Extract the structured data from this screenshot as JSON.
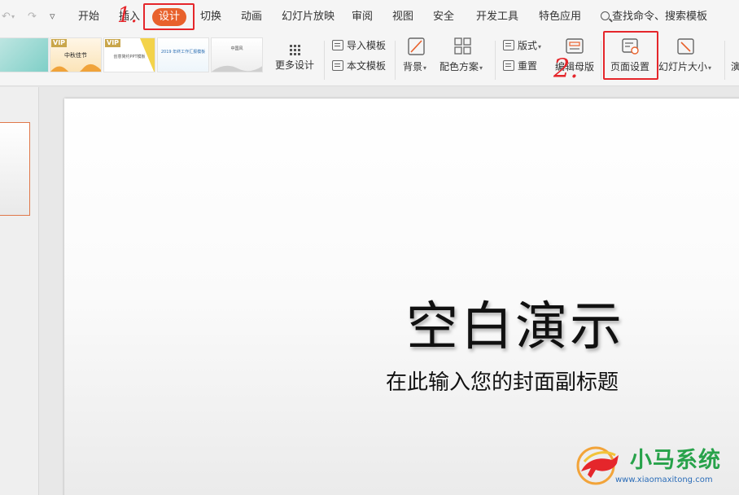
{
  "menu": {
    "tabs": [
      "开始",
      "插入",
      "设计",
      "切换",
      "动画",
      "幻灯片放映",
      "审阅",
      "视图",
      "安全",
      "开发工具",
      "特色应用"
    ],
    "active_tab": "设计",
    "search": "查找命令、搜索模板"
  },
  "ribbon": {
    "templates": [
      {
        "vip": "",
        "text": ""
      },
      {
        "vip": "VIP",
        "text": "中秋佳节"
      },
      {
        "vip": "VIP",
        "text": "创意简约PPT模板"
      },
      {
        "vip": "",
        "text": "2019 年终工作汇报模板"
      },
      {
        "vip": "",
        "text": "中国风"
      }
    ],
    "more_design": "更多设计",
    "import_template": "导入模板",
    "this_template": "本文模板",
    "background": "背景",
    "color_scheme": "配色方案",
    "layout": "版式",
    "reset": "重置",
    "edit_master": "编辑母版",
    "page_setup": "页面设置",
    "slide_size": "幻灯片大小",
    "partial_next": "演"
  },
  "slide": {
    "title": "空白演示",
    "subtitle": "在此输入您的封面副标题"
  },
  "annotations": {
    "step1": "1.",
    "step2": "2."
  },
  "watermark": {
    "name": "小马系统",
    "url": "www.xiaomaxitong.com"
  },
  "colors": {
    "accent": "#e8612c",
    "annotation_red": "#e5262b",
    "watermark_green": "#27a24a",
    "watermark_blue": "#2a6cb8"
  }
}
